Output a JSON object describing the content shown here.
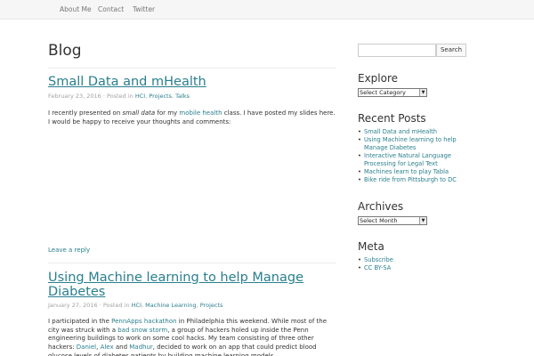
{
  "nav": {
    "items": [
      "About Me",
      "Contact",
      "Twitter"
    ]
  },
  "page_title": "Blog",
  "posts": [
    {
      "title": "Small Data and mHealth",
      "date": "February 23, 2016",
      "posted_in": "Posted in",
      "categories": [
        "HCI",
        "Projects",
        "Talks"
      ],
      "body": {
        "t1": "I recently presented on ",
        "t2": "small data",
        "t3": " for my ",
        "link1": "mobile health",
        "t4": " class. I have posted my slides here. I would be happy to receive your thoughts and comments:"
      },
      "reply": "Leave a reply"
    },
    {
      "title": "Using Machine learning to help Manage Diabetes",
      "date": "January 27, 2016",
      "posted_in": "Posted in",
      "categories": [
        "HCI",
        "Machine Learning",
        "Projects"
      ],
      "body": {
        "t1": "I participated in the ",
        "link1": "PennApps hackathon",
        "t2": " in Philadelphia this weekend. While most of the city was struck with a ",
        "link2": "bad snow storm",
        "t3": ", a group of hackers holed up inside the Penn engineering buildings to work on some cool hacks. My team consisting of three other hackers: ",
        "link3": "Daniel",
        "t4": ", ",
        "link4": "Alex",
        "t5": " and ",
        "link5": "Madhur",
        "t6": ", decided to work on an app that could predict blood glucose levels of diabetes patients by building machine learning models."
      }
    }
  ],
  "sidebar": {
    "search_button": "Search",
    "explore": {
      "title": "Explore",
      "select": "Select Category"
    },
    "recent": {
      "title": "Recent Posts",
      "items": [
        "Small Data and mHealth",
        "Using Machine learning to help Manage Diabetes",
        "Interactive Natural Language Processing for Legal Text",
        "Machines learn to play Tabla",
        "Bike ride from Pittsburgh to DC"
      ]
    },
    "archives": {
      "title": "Archives",
      "select": "Select Month"
    },
    "meta": {
      "title": "Meta",
      "items": [
        "Subscribe",
        "CC BY-SA"
      ]
    }
  }
}
